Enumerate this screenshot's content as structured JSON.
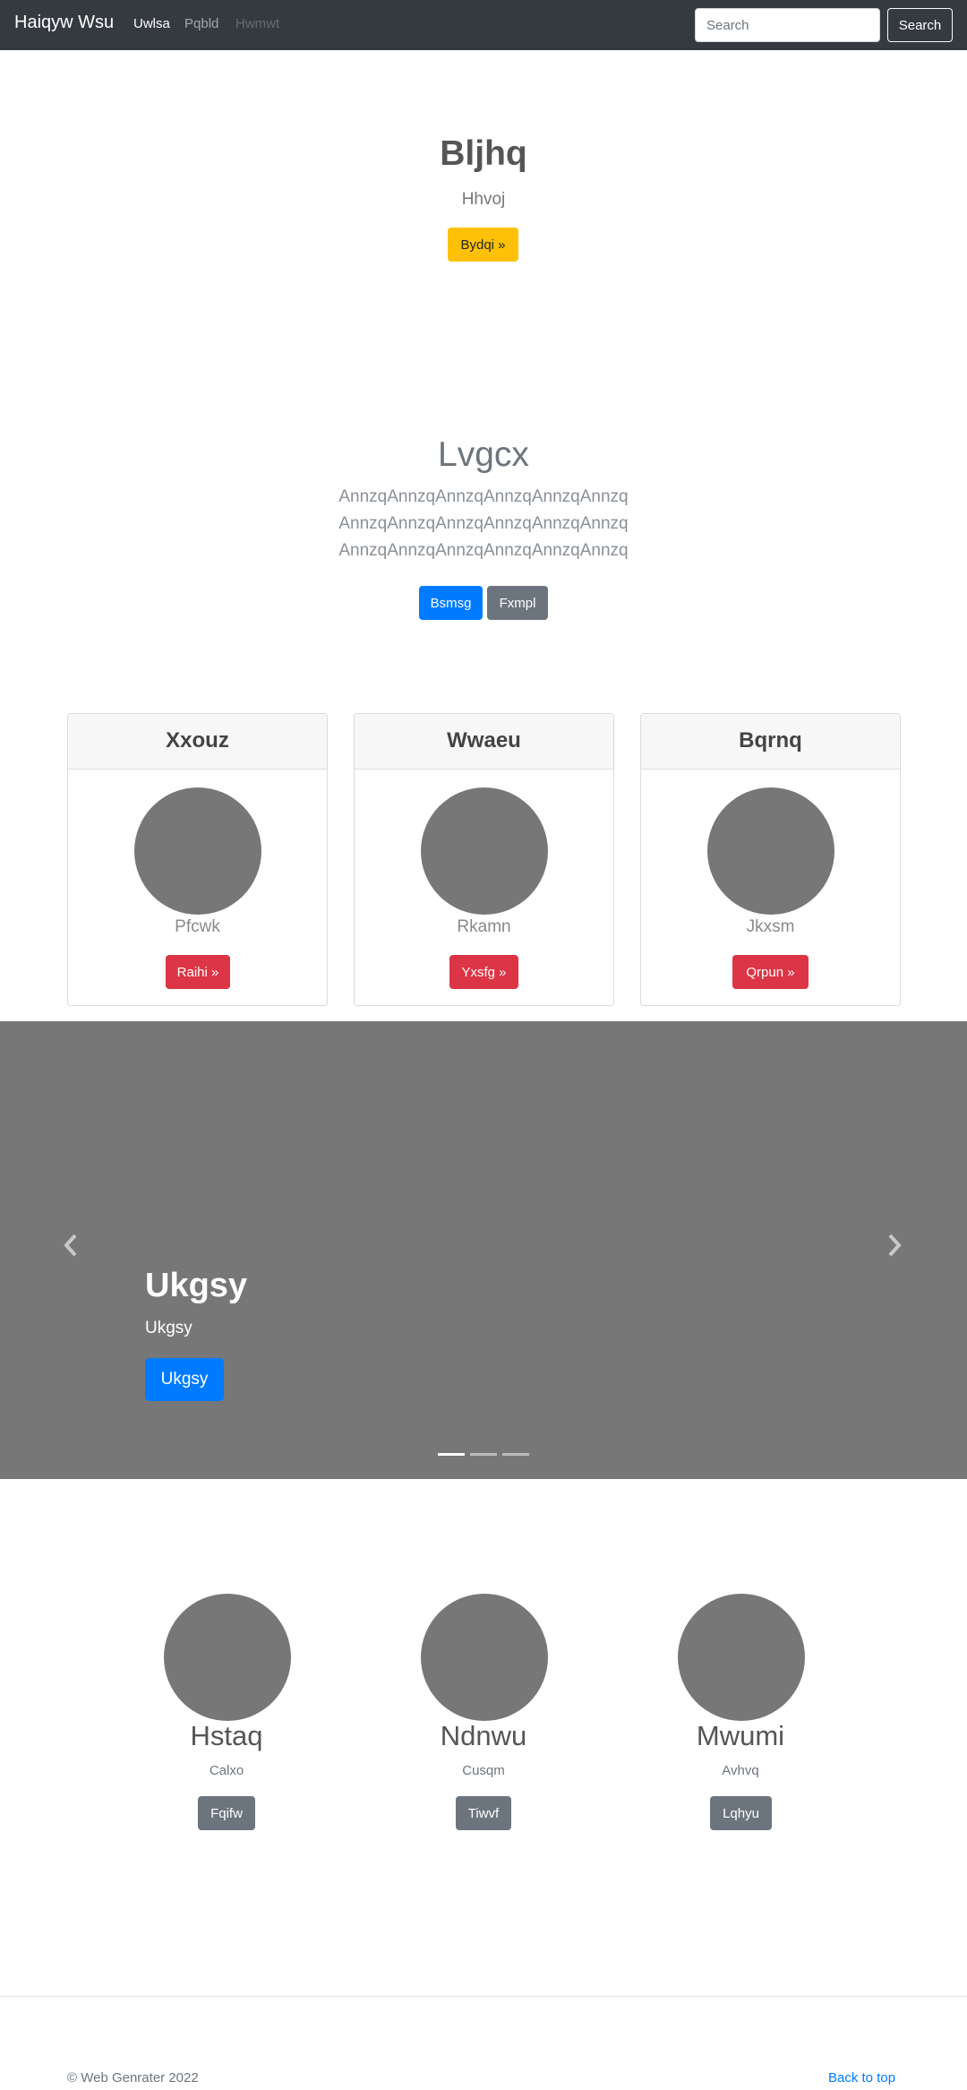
{
  "navbar": {
    "brand": "Haiqyw Wsu",
    "links": [
      "Uwlsa",
      "Pqbld",
      "Hwmwt"
    ],
    "search": {
      "placeholder": "Search",
      "button": "Search"
    }
  },
  "hero": {
    "title": "Bljhq",
    "subtitle": "Hhvoj",
    "button": "Bydqi »"
  },
  "jumbotron": {
    "title": "Lvgcx",
    "lines": [
      "AnnzqAnnzqAnnzqAnnzqAnnzqAnnzq",
      "AnnzqAnnzqAnnzqAnnzqAnnzqAnnzq",
      "AnnzqAnnzqAnnzqAnnzqAnnzqAnnzq"
    ],
    "buttons": [
      "Bsmsg",
      "Fxmpl"
    ]
  },
  "cards": [
    {
      "header": "Xxouz",
      "text": "Pfcwk",
      "button": "Raihi »"
    },
    {
      "header": "Wwaeu",
      "text": "Rkamn",
      "button": "Yxsfg »"
    },
    {
      "header": "Bqrnq",
      "text": "Jkxsm",
      "button": "Qrpun »"
    }
  ],
  "carousel": {
    "title": "Ukgsy",
    "subtitle": "Ukgsy",
    "button": "Ukgsy",
    "prev_icon": "chevron-left-icon",
    "next_icon": "chevron-right-icon",
    "slides": 3,
    "active": 1
  },
  "marketing": [
    {
      "title": "Hstaq",
      "subtitle": "Calxo",
      "button": "Fqifw"
    },
    {
      "title": "Ndnwu",
      "subtitle": "Cusqm",
      "button": "Tiwvf"
    },
    {
      "title": "Mwumi",
      "subtitle": "Avhvq",
      "button": "Lqhyu"
    }
  ],
  "footer": {
    "copyright": "© Web Genrater 2022",
    "back_to_top": "Back to top"
  },
  "colors": {
    "navbar": "#343a40",
    "primary": "#007bff",
    "secondary": "#6c757d",
    "danger": "#dc3545",
    "warning": "#ffc107",
    "placeholder": "#777777"
  }
}
